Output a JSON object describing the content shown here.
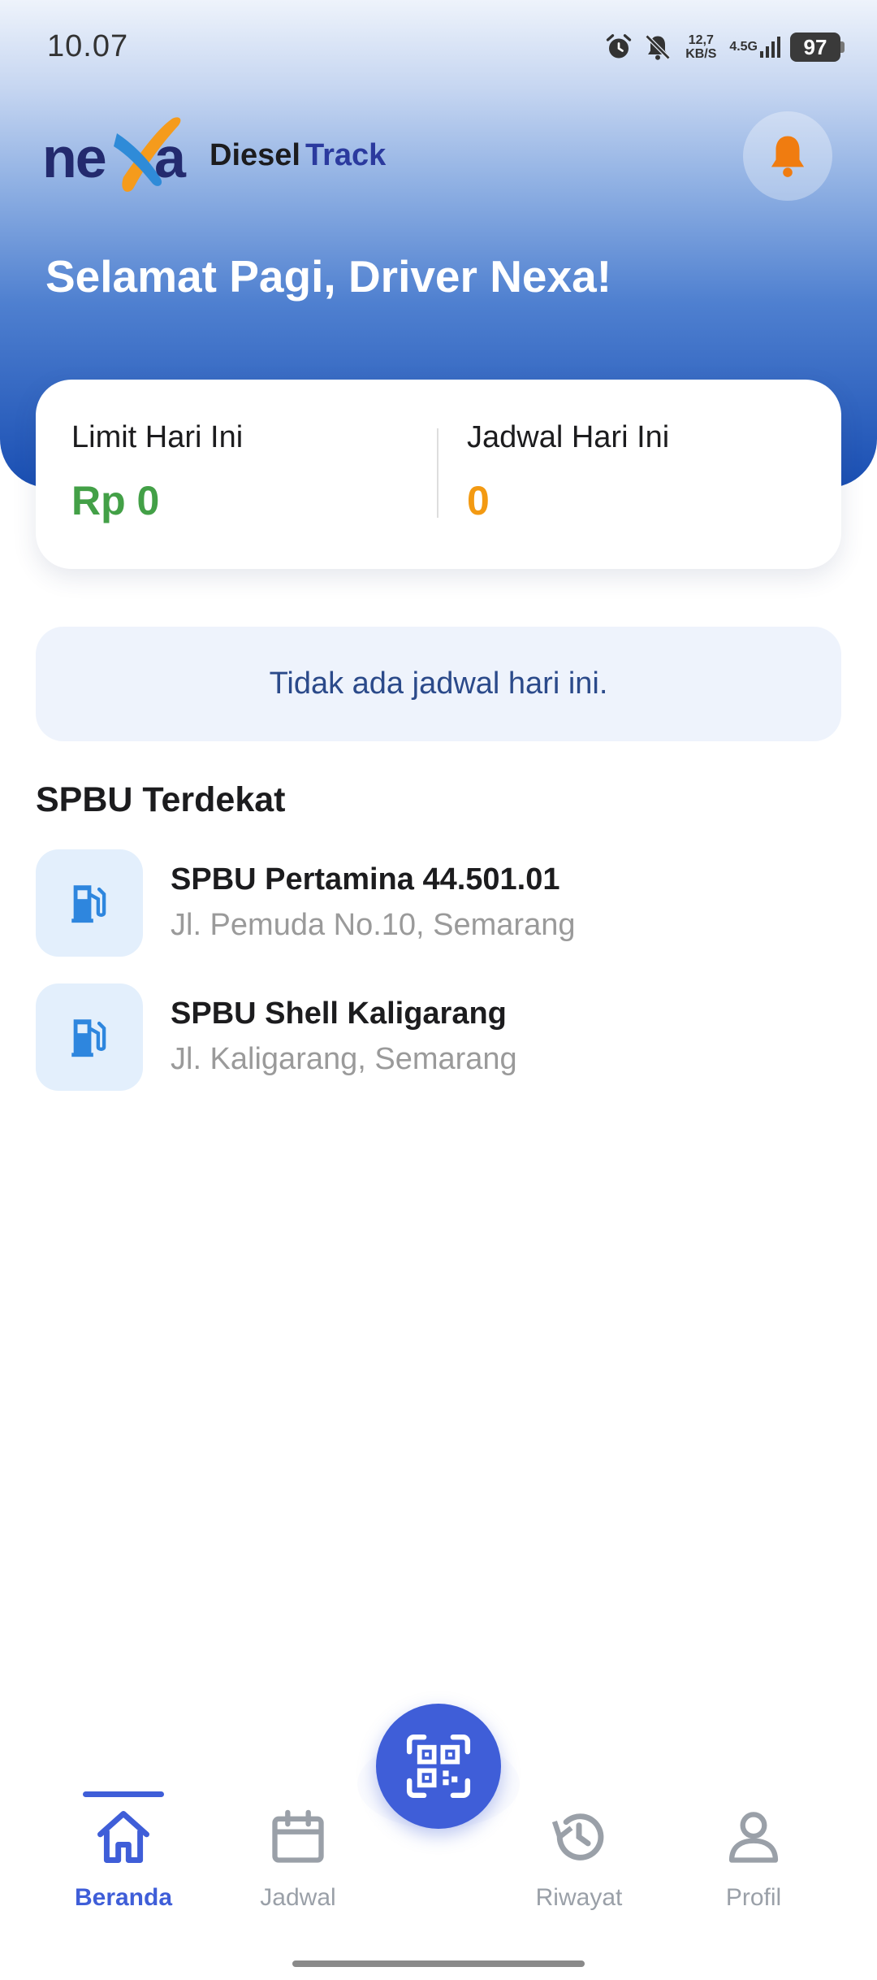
{
  "status_bar": {
    "time": "10.07",
    "speed_value": "12,7",
    "speed_unit": "KB/S",
    "network": "4.5G",
    "battery": "97"
  },
  "app_bar": {
    "brand_primary": "Diesel",
    "brand_accent": "Track",
    "logo_icon": "nexa-logo",
    "notification_icon": "bell-icon"
  },
  "greeting": "Selamat Pagi, Driver Nexa!",
  "summary": {
    "limit_label": "Limit Hari Ini",
    "limit_value": "Rp 0",
    "schedule_label": "Jadwal Hari Ini",
    "schedule_value": "0"
  },
  "notice": "Tidak ada jadwal hari ini.",
  "nearby": {
    "title": "SPBU Terdekat",
    "stations": [
      {
        "name": "SPBU Pertamina 44.501.01",
        "address": "Jl. Pemuda No.10, Semarang",
        "icon": "fuel-pump-icon"
      },
      {
        "name": "SPBU Shell Kaligarang",
        "address": "Jl. Kaligarang, Semarang",
        "icon": "fuel-pump-icon"
      }
    ]
  },
  "nav": {
    "items": [
      {
        "label": "Beranda",
        "icon": "home-icon",
        "active": true
      },
      {
        "label": "Jadwal",
        "icon": "calendar-icon",
        "active": false
      },
      {
        "label": "Riwayat",
        "icon": "history-icon",
        "active": false
      },
      {
        "label": "Profil",
        "icon": "profile-icon",
        "active": false
      }
    ],
    "scan_icon": "qr-scan-icon"
  },
  "colors": {
    "primary": "#3f5ed8",
    "limit_value": "#43a047",
    "schedule_value": "#f39a12",
    "bell": "#f07c10",
    "header_bottom": "#1a4fb3"
  }
}
